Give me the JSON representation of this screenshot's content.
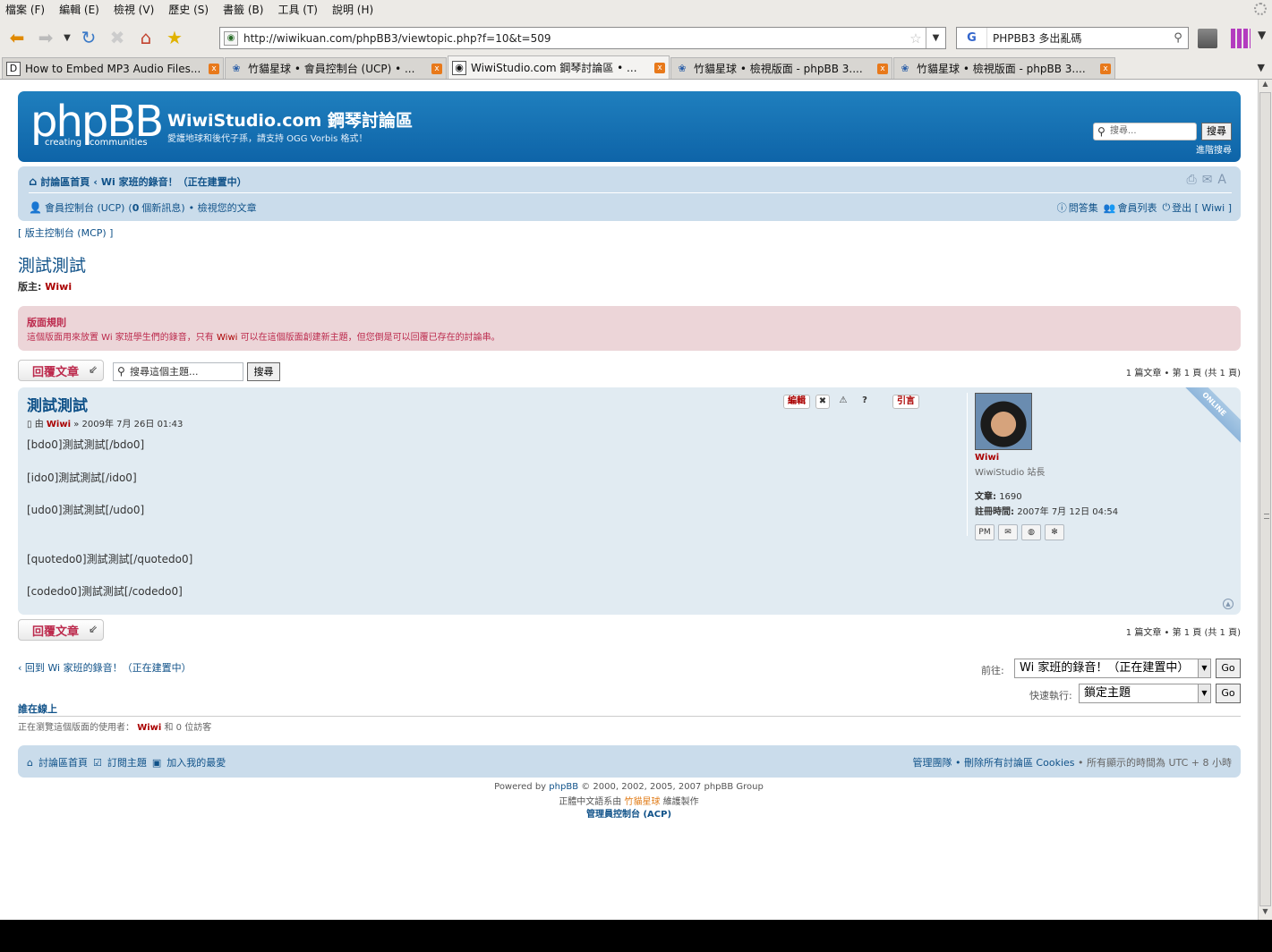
{
  "menu": [
    "檔案 (F)",
    "編輯 (E)",
    "檢視 (V)",
    "歷史 (S)",
    "書籤 (B)",
    "工具 (T)",
    "說明 (H)"
  ],
  "nav": {
    "url": "http://wiwikuan.com/phpBB3/viewtopic.php?f=10&t=509",
    "search_engine": "G",
    "search_text": "PHPBB3 多出亂碼"
  },
  "tabs": [
    {
      "title": "How to Embed MP3 Audio Files...",
      "icon": "doc",
      "active": false
    },
    {
      "title": "竹貓星球 • 會員控制台 (UCP) • ...",
      "icon": "php",
      "active": false
    },
    {
      "title": "WiwiStudio.com 鋼琴討論區 • ...",
      "icon": "site",
      "active": true
    },
    {
      "title": "竹貓星球 • 檢視版面 - phpBB 3....",
      "icon": "php",
      "active": false
    },
    {
      "title": "竹貓星球 • 檢視版面 - phpBB 3....",
      "icon": "php",
      "active": false
    }
  ],
  "header": {
    "logo_text": "phpBB",
    "logo_sub1": "creating",
    "logo_sub2": "communities",
    "site_title": "WiwiStudio.com 鋼琴討論區",
    "site_desc": "愛護地球和後代子孫，請支持 OGG Vorbis 格式！",
    "search_placeholder": "搜尋...",
    "search_button": "搜尋",
    "advanced_search": "進階搜尋"
  },
  "navbar": {
    "crumb_home": "討論區首頁",
    "crumb_sep": "‹",
    "crumb_forum": "Wi 家班的錄音！（正在建置中）",
    "ucp_link": "會員控制台 (UCP)",
    "pm_open": "(",
    "pm_count": "0",
    "pm_text": "個新訊息)",
    "view_own": "• 檢視您的文章",
    "faq": "問答集",
    "members": "會員列表",
    "logout": "登出 [ Wiwi ]"
  },
  "mcp": "[ 版主控制台 (MCP) ]",
  "forum": {
    "title": "測試測試",
    "mods_label": "版主:",
    "mods_name": "Wiwi"
  },
  "rules": {
    "title": "版面規則",
    "text_a": "這個版面用來放置 Wi 家班學生們的錄音，只有",
    "text_name": "Wiwi",
    "text_b": "可以在這個版面創建新主題，但您倒是可以回覆已存在的討論串。"
  },
  "actions": {
    "reply": "回覆文章",
    "topic_search_placeholder": "搜尋這個主題...",
    "topic_search_button": "搜尋",
    "pagination": "1 篇文章 • 第 1 頁 (共 1 頁)"
  },
  "post": {
    "title": "測試測試",
    "meta_by": "由",
    "author": "Wiwi",
    "date": "» 2009年 7月 26日 01:43",
    "edit": "編輯",
    "quote": "引言",
    "lines": [
      "[bdo0]測試測試[/bdo0]",
      "[ido0]測試測試[/ido0]",
      "[udo0]測試測試[/udo0]",
      "[quotedo0]測試測試[/quotedo0]",
      "[codedo0]測試測試[/codedo0]"
    ],
    "online": "ONLINE"
  },
  "profile": {
    "name": "Wiwi",
    "rank": "WiwiStudio 站長",
    "posts_label": "文章:",
    "posts": "1690",
    "joined_label": "註冊時間:",
    "joined": "2007年 7月 12日 04:54"
  },
  "bottom": {
    "back_link": "回到 Wi 家班的錄音！（正在建置中）",
    "jump_label": "前往:",
    "jump_value": "Wi 家班的錄音！（正在建置中）",
    "quick_label": "快速執行:",
    "quick_value": "鎖定主題",
    "go": "Go"
  },
  "who": {
    "title": "誰在線上",
    "text_a": "正在瀏覽這個版面的使用者：",
    "name": "Wiwi",
    "text_b": "和 0 位訪客"
  },
  "footer": {
    "home": "討論區首頁",
    "subscribe": "訂閱主題",
    "bookmark": "加入我的最愛",
    "team": "管理團隊",
    "cookies": "• 刪除所有討論區 Cookies",
    "timezone": "• 所有顯示的時間為 UTC + 8 小時",
    "powered_a": "Powered by",
    "powered_link": "phpBB",
    "powered_b": "© 2000, 2002, 2005, 2007 phpBB Group",
    "trans_a": "正體中文語系由",
    "trans_link": "竹貓星球",
    "trans_b": "維護製作",
    "acp": "管理員控制台 (ACP)"
  }
}
